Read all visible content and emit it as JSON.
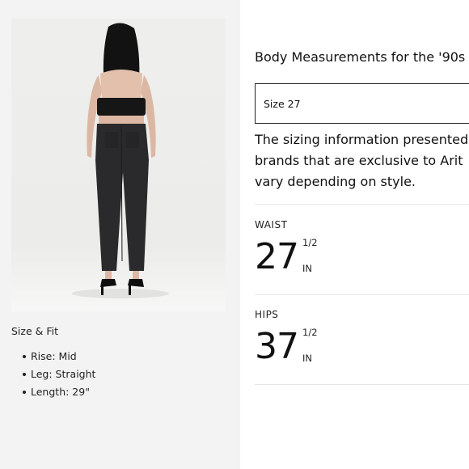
{
  "size_fit": {
    "title": "Size & Fit",
    "items": [
      "Rise: Mid",
      "Leg: Straight",
      "Length: 29\""
    ]
  },
  "measurements": {
    "title": "Body Measurements for the '90s",
    "size_selected": "Size 27",
    "info_lines": [
      "The sizing information presented",
      "brands that are exclusive to Arit",
      "vary depending on style."
    ],
    "waist": {
      "label": "WAIST",
      "value": "27",
      "fraction": "1/2",
      "unit": "IN"
    },
    "hips": {
      "label": "HIPS",
      "value": "37",
      "fraction": "1/2",
      "unit": "IN"
    }
  },
  "colors": {
    "left_panel_bg": "#f3f3f3",
    "photo_bg": "#eeeeec",
    "text": "#111111",
    "divider": "#e6e6e6"
  }
}
